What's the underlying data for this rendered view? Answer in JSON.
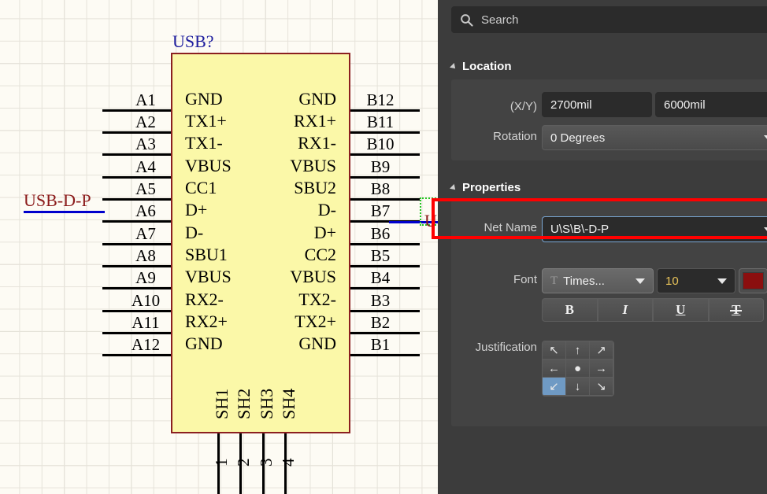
{
  "canvas": {
    "designator": "USB?",
    "net_label_left": "USB-D-P",
    "net_label_right": "U",
    "left_pins": [
      {
        "num": "A1",
        "name": "GND"
      },
      {
        "num": "A2",
        "name": "TX1+"
      },
      {
        "num": "A3",
        "name": "TX1-"
      },
      {
        "num": "A4",
        "name": "VBUS"
      },
      {
        "num": "A5",
        "name": "CC1"
      },
      {
        "num": "A6",
        "name": "D+"
      },
      {
        "num": "A7",
        "name": "D-"
      },
      {
        "num": "A8",
        "name": "SBU1"
      },
      {
        "num": "A9",
        "name": "VBUS"
      },
      {
        "num": "A10",
        "name": "RX2-"
      },
      {
        "num": "A11",
        "name": "RX2+"
      },
      {
        "num": "A12",
        "name": "GND"
      }
    ],
    "right_pins": [
      {
        "num": "B12",
        "name": "GND"
      },
      {
        "num": "B11",
        "name": "RX1+"
      },
      {
        "num": "B10",
        "name": "RX1-"
      },
      {
        "num": "B9",
        "name": "VBUS"
      },
      {
        "num": "B8",
        "name": "SBU2"
      },
      {
        "num": "B7",
        "name": "D-"
      },
      {
        "num": "B6",
        "name": "D+"
      },
      {
        "num": "B5",
        "name": "CC2"
      },
      {
        "num": "B4",
        "name": "VBUS"
      },
      {
        "num": "B3",
        "name": "TX2-"
      },
      {
        "num": "B2",
        "name": "TX2+"
      },
      {
        "num": "B1",
        "name": "GND"
      }
    ],
    "shield_pins": [
      {
        "num": "1",
        "name": "SH1"
      },
      {
        "num": "2",
        "name": "SH2"
      },
      {
        "num": "3",
        "name": "SH3"
      },
      {
        "num": "4",
        "name": "SH4"
      }
    ],
    "colors": {
      "body_fill": "#fbf8a8",
      "body_border": "#8b2020",
      "designator": "#1d1d9e",
      "net_label": "#8b1a1a",
      "wire": "#0000cc",
      "selection": "#22c522"
    }
  },
  "panel": {
    "search": {
      "placeholder": "Search",
      "value": "",
      "icon": "search-icon"
    },
    "location": {
      "title": "Location",
      "xy_label": "(X/Y)",
      "x_value": "2700mil",
      "y_value": "6000mil",
      "rotation_label": "Rotation",
      "rotation_value": "0 Degrees"
    },
    "properties": {
      "title": "Properties",
      "net_name_label": "Net Name",
      "net_name_value": "U\\S\\B\\-D-P",
      "font_label": "Font",
      "font_name": "Times...",
      "font_size": "10",
      "font_color": "#8b0f0f",
      "style_buttons": [
        {
          "name": "bold-button",
          "glyph": "B"
        },
        {
          "name": "italic-button",
          "glyph": "I"
        },
        {
          "name": "underline-button",
          "glyph": "U"
        },
        {
          "name": "strikethrough-button",
          "glyph": "T"
        }
      ],
      "justification_label": "Justification",
      "justification_cells": [
        {
          "name": "justify-top-left",
          "glyph": "↖",
          "selected": false
        },
        {
          "name": "justify-top-center",
          "glyph": "↑",
          "selected": false
        },
        {
          "name": "justify-top-right",
          "glyph": "↗",
          "selected": false
        },
        {
          "name": "justify-middle-left",
          "glyph": "←",
          "selected": false
        },
        {
          "name": "justify-middle-center",
          "glyph": "●",
          "selected": false
        },
        {
          "name": "justify-middle-right",
          "glyph": "→",
          "selected": false
        },
        {
          "name": "justify-bottom-left",
          "glyph": "↙",
          "selected": true
        },
        {
          "name": "justify-bottom-center",
          "glyph": "↓",
          "selected": false
        },
        {
          "name": "justify-bottom-right",
          "glyph": "↘",
          "selected": false
        }
      ]
    }
  },
  "annotation": {
    "highlight_color": "#ff0000"
  }
}
